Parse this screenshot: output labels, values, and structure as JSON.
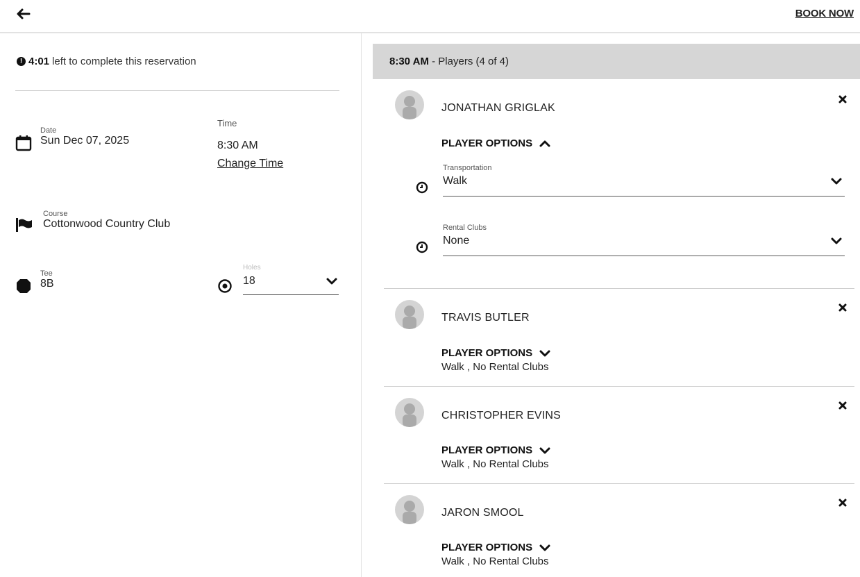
{
  "header": {
    "book_now": "BOOK NOW"
  },
  "timer": {
    "time": "4:01",
    "text": "left to complete this reservation"
  },
  "reservation": {
    "date_label": "Date",
    "date_value": "Sun Dec 07, 2025",
    "time_label": "Time",
    "time_value": "8:30 AM",
    "change_time": "Change Time",
    "course_label": "Course",
    "course_value": "Cottonwood Country Club",
    "tee_label": "Tee",
    "tee_value": "8B",
    "holes_label": "Holes",
    "holes_value": "18"
  },
  "players_header": {
    "time": "8:30 AM",
    "text": "- Players (4 of 4)"
  },
  "players": [
    {
      "name": "JONATHAN GRIGLAK",
      "options_label": "PLAYER OPTIONS",
      "expanded": true,
      "transportation_label": "Transportation",
      "transportation_value": "Walk",
      "rental_label": "Rental Clubs",
      "rental_value": "None"
    },
    {
      "name": "TRAVIS BUTLER",
      "options_label": "PLAYER OPTIONS",
      "summary": "Walk , No Rental Clubs"
    },
    {
      "name": "CHRISTOPHER EVINS",
      "options_label": "PLAYER OPTIONS",
      "summary": "Walk , No Rental Clubs"
    },
    {
      "name": "JARON SMOOL",
      "options_label": "PLAYER OPTIONS",
      "summary": "Walk , No Rental Clubs"
    }
  ],
  "icons": {
    "back": "arrow-left-icon",
    "info": "info-icon",
    "date": "calendar-icon",
    "course": "flag-icon",
    "tee": "octagon-icon",
    "holes": "target-icon",
    "option": "clock-icon",
    "remove": "close-icon",
    "avatar": "person-silhouette"
  }
}
